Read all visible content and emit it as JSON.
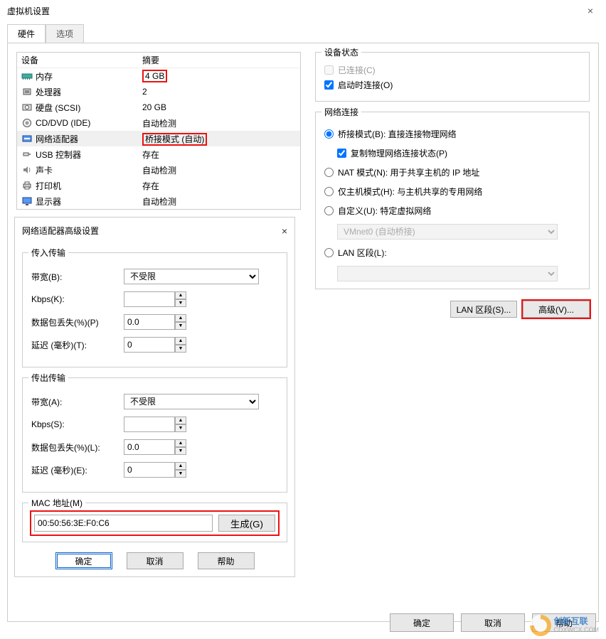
{
  "window": {
    "title": "虚拟机设置",
    "close_label": "×"
  },
  "tabs": {
    "hardware": "硬件",
    "options": "选项"
  },
  "device_table": {
    "header_device": "设备",
    "header_summary": "摘要",
    "rows": [
      {
        "icon": "memory-icon",
        "name": "内存",
        "summary": "4 GB",
        "highlight_summary": true
      },
      {
        "icon": "cpu-icon",
        "name": "处理器",
        "summary": "2"
      },
      {
        "icon": "disk-icon",
        "name": "硬盘 (SCSI)",
        "summary": "20 GB"
      },
      {
        "icon": "cd-icon",
        "name": "CD/DVD (IDE)",
        "summary": "自动检测"
      },
      {
        "icon": "nic-icon",
        "name": "网络适配器",
        "summary": "桥接模式 (自动)",
        "highlight_summary": true,
        "selected": true
      },
      {
        "icon": "usb-icon",
        "name": "USB 控制器",
        "summary": "存在"
      },
      {
        "icon": "sound-icon",
        "name": "声卡",
        "summary": "自动检测"
      },
      {
        "icon": "printer-icon",
        "name": "打印机",
        "summary": "存在"
      },
      {
        "icon": "display-icon",
        "name": "显示器",
        "summary": "自动检测"
      }
    ]
  },
  "device_status": {
    "legend": "设备状态",
    "connected": "已连接(C)",
    "connect_at_power_on": "启动时连接(O)"
  },
  "network": {
    "legend": "网络连接",
    "bridged": "桥接模式(B): 直接连接物理网络",
    "replicate": "复制物理网络连接状态(P)",
    "nat": "NAT 模式(N): 用于共享主机的 IP 地址",
    "hostonly": "仅主机模式(H): 与主机共享的专用网络",
    "custom": "自定义(U): 特定虚拟网络",
    "custom_value": "VMnet0 (自动桥接)",
    "lan_segment": "LAN 区段(L):",
    "lan_segment_value": "",
    "btn_lan_segments": "LAN 区段(S)...",
    "btn_advanced": "高级(V)..."
  },
  "adv_dialog": {
    "title": "网络适配器高级设置",
    "close": "×",
    "incoming_legend": "传入传输",
    "outgoing_legend": "传出传输",
    "bandwidth_in_lbl": "带宽(B):",
    "bandwidth_out_lbl": "带宽(A):",
    "kbps_in_lbl": "Kbps(K):",
    "kbps_out_lbl": "Kbps(S):",
    "pkt_loss_in_lbl": "数据包丢失(%)(P)",
    "pkt_loss_out_lbl": "数据包丢失(%)(L):",
    "latency_in_lbl": "延迟 (毫秒)(T):",
    "latency_out_lbl": "延迟 (毫秒)(E):",
    "bandwidth_unlimited": "不受限",
    "kbps_in": "",
    "kbps_out": "",
    "pkt_loss_in": "0.0",
    "pkt_loss_out": "0.0",
    "latency_in": "0",
    "latency_out": "0",
    "mac_legend": "MAC 地址(M)",
    "mac_value": "00:50:56:3E:F0:C6",
    "btn_generate": "生成(G)",
    "btn_ok": "确定",
    "btn_cancel": "取消",
    "btn_help": "帮助"
  },
  "main_buttons": {
    "ok": "确定",
    "cancel": "取消",
    "help": "帮助"
  },
  "watermark": {
    "line1": "创新互联",
    "line2": "CDXWCX.COM"
  }
}
